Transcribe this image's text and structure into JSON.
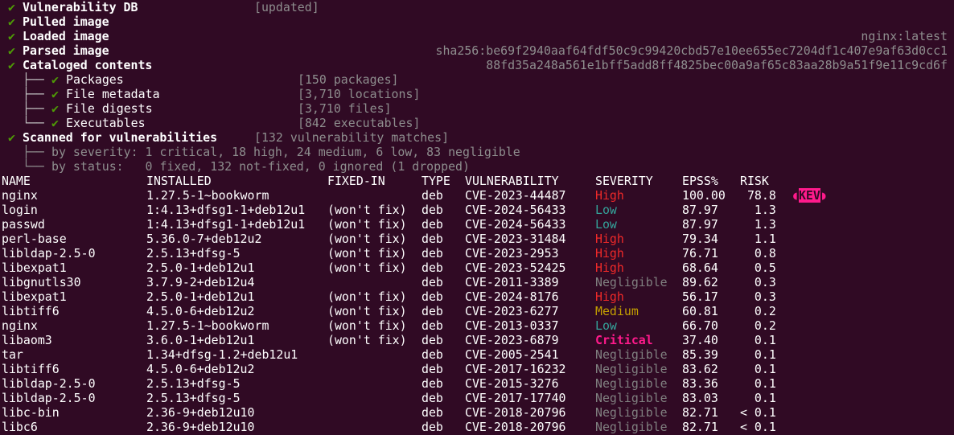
{
  "colors": {
    "background": "#300a24",
    "check": "#4e9a06",
    "high": "#ef2929",
    "low": "#34a39a",
    "medium": "#c4a000",
    "negligible": "#808080",
    "critical": "#ff1a8c"
  },
  "status": {
    "check_glyph": "✔",
    "vulndb_label": "Vulnerability DB",
    "vulndb_status": "[updated]",
    "pulled_label": "Pulled image",
    "loaded_label": "Loaded image",
    "loaded_value": "nginx:latest",
    "parsed_label": "Parsed image",
    "parsed_value": "sha256:be69f2940aaf64fdf50c9c99420cbd57e10ee655ec7204df1c407e9af63d0cc1",
    "cataloged_label": "Cataloged contents",
    "cataloged_value": "88fd35a248a561e1bff5add8ff4825bec00a9af65c83aa28b9a51f9e11c9cd6f",
    "packages_label": "Packages",
    "packages_value": "[150 packages]",
    "file_metadata_label": "File metadata",
    "file_metadata_value": "[3,710 locations]",
    "file_digests_label": "File digests",
    "file_digests_value": "[3,710 files]",
    "executables_label": "Executables",
    "executables_value": "[842 executables]",
    "scanned_label": "Scanned for vulnerabilities",
    "scanned_value": "[132 vulnerability matches]",
    "severity_line": "by severity: 1 critical, 18 high, 24 medium, 6 low, 83 negligible",
    "status_line": "by status:   0 fixed, 132 not-fixed, 0 ignored (1 dropped)"
  },
  "table": {
    "headers": {
      "name": "NAME",
      "installed": "INSTALLED",
      "fixed_in": "FIXED-IN",
      "type": "TYPE",
      "vulnerability": "VULNERABILITY",
      "severity": "SEVERITY",
      "epss": "EPSS%",
      "risk": "RISK"
    },
    "rows": [
      {
        "name": "nginx",
        "installed": "1.27.5-1~bookworm",
        "fixed_in": "",
        "type": "deb",
        "vulnerability": "CVE-2023-44487",
        "severity": "High",
        "epss": "100.00",
        "risk": " 78.8",
        "kev": "KEV"
      },
      {
        "name": "login",
        "installed": "1:4.13+dfsg1-1+deb12u1",
        "fixed_in": "(won't fix)",
        "type": "deb",
        "vulnerability": "CVE-2024-56433",
        "severity": "Low",
        "epss": "87.97",
        "risk": "  1.3",
        "kev": ""
      },
      {
        "name": "passwd",
        "installed": "1:4.13+dfsg1-1+deb12u1",
        "fixed_in": "(won't fix)",
        "type": "deb",
        "vulnerability": "CVE-2024-56433",
        "severity": "Low",
        "epss": "87.97",
        "risk": "  1.3",
        "kev": ""
      },
      {
        "name": "perl-base",
        "installed": "5.36.0-7+deb12u2",
        "fixed_in": "(won't fix)",
        "type": "deb",
        "vulnerability": "CVE-2023-31484",
        "severity": "High",
        "epss": "79.34",
        "risk": "  1.1",
        "kev": ""
      },
      {
        "name": "libldap-2.5-0",
        "installed": "2.5.13+dfsg-5",
        "fixed_in": "(won't fix)",
        "type": "deb",
        "vulnerability": "CVE-2023-2953",
        "severity": "High",
        "epss": "76.71",
        "risk": "  0.8",
        "kev": ""
      },
      {
        "name": "libexpat1",
        "installed": "2.5.0-1+deb12u1",
        "fixed_in": "(won't fix)",
        "type": "deb",
        "vulnerability": "CVE-2023-52425",
        "severity": "High",
        "epss": "68.64",
        "risk": "  0.5",
        "kev": ""
      },
      {
        "name": "libgnutls30",
        "installed": "3.7.9-2+deb12u4",
        "fixed_in": "",
        "type": "deb",
        "vulnerability": "CVE-2011-3389",
        "severity": "Negligible",
        "epss": "89.62",
        "risk": "  0.3",
        "kev": ""
      },
      {
        "name": "libexpat1",
        "installed": "2.5.0-1+deb12u1",
        "fixed_in": "(won't fix)",
        "type": "deb",
        "vulnerability": "CVE-2024-8176",
        "severity": "High",
        "epss": "56.17",
        "risk": "  0.3",
        "kev": ""
      },
      {
        "name": "libtiff6",
        "installed": "4.5.0-6+deb12u2",
        "fixed_in": "(won't fix)",
        "type": "deb",
        "vulnerability": "CVE-2023-6277",
        "severity": "Medium",
        "epss": "60.81",
        "risk": "  0.2",
        "kev": ""
      },
      {
        "name": "nginx",
        "installed": "1.27.5-1~bookworm",
        "fixed_in": "(won't fix)",
        "type": "deb",
        "vulnerability": "CVE-2013-0337",
        "severity": "Low",
        "epss": "66.70",
        "risk": "  0.2",
        "kev": ""
      },
      {
        "name": "libaom3",
        "installed": "3.6.0-1+deb12u1",
        "fixed_in": "(won't fix)",
        "type": "deb",
        "vulnerability": "CVE-2023-6879",
        "severity": "Critical",
        "epss": "37.40",
        "risk": "  0.1",
        "kev": ""
      },
      {
        "name": "tar",
        "installed": "1.34+dfsg-1.2+deb12u1",
        "fixed_in": "",
        "type": "deb",
        "vulnerability": "CVE-2005-2541",
        "severity": "Negligible",
        "epss": "85.39",
        "risk": "  0.1",
        "kev": ""
      },
      {
        "name": "libtiff6",
        "installed": "4.5.0-6+deb12u2",
        "fixed_in": "",
        "type": "deb",
        "vulnerability": "CVE-2017-16232",
        "severity": "Negligible",
        "epss": "83.62",
        "risk": "  0.1",
        "kev": ""
      },
      {
        "name": "libldap-2.5-0",
        "installed": "2.5.13+dfsg-5",
        "fixed_in": "",
        "type": "deb",
        "vulnerability": "CVE-2015-3276",
        "severity": "Negligible",
        "epss": "83.36",
        "risk": "  0.1",
        "kev": ""
      },
      {
        "name": "libldap-2.5-0",
        "installed": "2.5.13+dfsg-5",
        "fixed_in": "",
        "type": "deb",
        "vulnerability": "CVE-2017-17740",
        "severity": "Negligible",
        "epss": "83.03",
        "risk": "  0.1",
        "kev": ""
      },
      {
        "name": "libc-bin",
        "installed": "2.36-9+deb12u10",
        "fixed_in": "",
        "type": "deb",
        "vulnerability": "CVE-2018-20796",
        "severity": "Negligible",
        "epss": "82.71",
        "risk": "< 0.1",
        "kev": ""
      },
      {
        "name": "libc6",
        "installed": "2.36-9+deb12u10",
        "fixed_in": "",
        "type": "deb",
        "vulnerability": "CVE-2018-20796",
        "severity": "Negligible",
        "epss": "82.71",
        "risk": "< 0.1",
        "kev": ""
      }
    ]
  }
}
